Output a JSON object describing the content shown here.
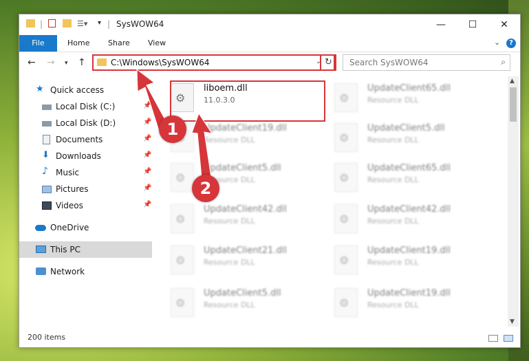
{
  "window": {
    "title": "SysWOW64"
  },
  "ribbon": {
    "tabs": [
      "File",
      "Home",
      "Share",
      "View"
    ],
    "help": "?"
  },
  "nav": {
    "address": "C:\\Windows\\SysWOW64",
    "search_placeholder": "Search SysWOW64"
  },
  "sidebar": {
    "items": [
      {
        "label": "Quick access",
        "icon": "star-icon"
      },
      {
        "label": "Local Disk (C:)",
        "icon": "drive-icon",
        "pinned": true
      },
      {
        "label": "Local Disk (D:)",
        "icon": "drive-icon",
        "pinned": true
      },
      {
        "label": "Documents",
        "icon": "document-icon",
        "pinned": true
      },
      {
        "label": "Downloads",
        "icon": "download-icon",
        "pinned": true
      },
      {
        "label": "Music",
        "icon": "music-icon",
        "pinned": true
      },
      {
        "label": "Pictures",
        "icon": "picture-icon",
        "pinned": true
      },
      {
        "label": "Videos",
        "icon": "video-icon",
        "pinned": true
      },
      {
        "label": "OneDrive",
        "icon": "cloud-icon"
      },
      {
        "label": "This PC",
        "icon": "computer-icon",
        "selected": true
      },
      {
        "label": "Network",
        "icon": "network-icon"
      }
    ]
  },
  "files": {
    "highlight": {
      "name": "liboem.dll",
      "sub": "11.0.3.0"
    },
    "col1": [
      {
        "name": "UpdateClient19.dll",
        "sub": "Resource DLL"
      },
      {
        "name": "UpdateClient5.dll",
        "sub": "Resource DLL"
      },
      {
        "name": "UpdateClient42.dll",
        "sub": "Resource DLL"
      },
      {
        "name": "UpdateClient21.dll",
        "sub": "Resource DLL"
      },
      {
        "name": "UpdateClient5.dll",
        "sub": "Resource DLL"
      }
    ],
    "col2": [
      {
        "name": "UpdateClient65.dll",
        "sub": "Resource DLL"
      },
      {
        "name": "UpdateClient5.dll",
        "sub": "Resource DLL"
      },
      {
        "name": "UpdateClient65.dll",
        "sub": "Resource DLL"
      },
      {
        "name": "UpdateClient42.dll",
        "sub": "Resource DLL"
      },
      {
        "name": "UpdateClient19.dll",
        "sub": "Resource DLL"
      },
      {
        "name": "UpdateClient19.dll",
        "sub": "Resource DLL"
      }
    ]
  },
  "status": {
    "count": "200 items"
  },
  "callouts": [
    "1",
    "2"
  ],
  "colors": {
    "accent": "#1979ca",
    "highlight": "#d6353a"
  }
}
